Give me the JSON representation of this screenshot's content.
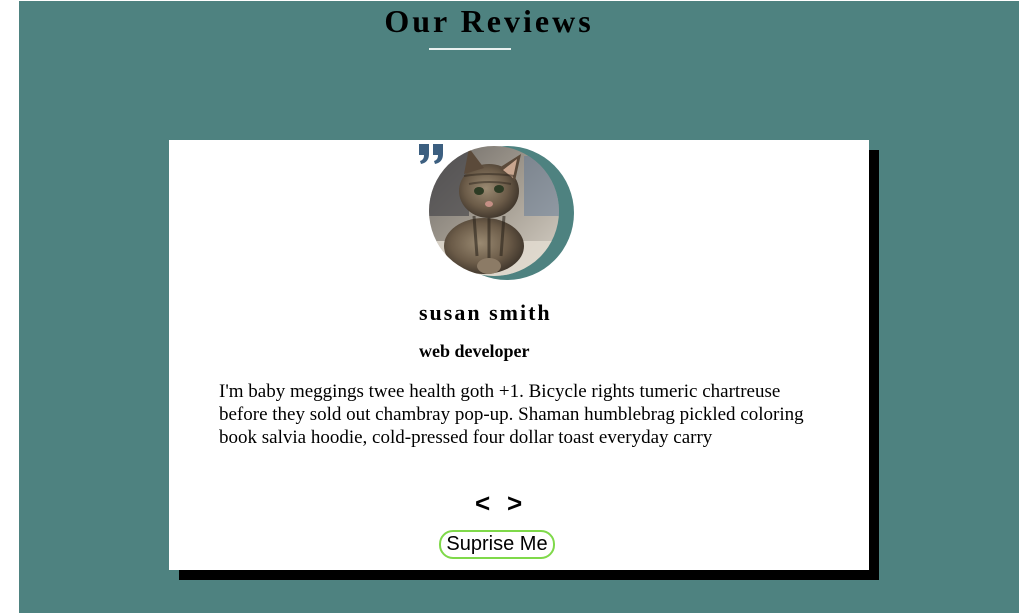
{
  "header": {
    "title": "Our Reviews"
  },
  "review": {
    "name": "susan smith",
    "job": "web developer",
    "text": "I'm baby meggings twee health goth +1. Bicycle rights tumeric chartreuse before they sold out chambray pop-up. Shaman humblebrag pickled coloring book salvia hoodie, cold-pressed four dollar toast everyday carry",
    "avatar_icon": "cat-photo",
    "quote_icon": "quote-right-icon"
  },
  "controls": {
    "prev_label": "<",
    "next_label": ">",
    "random_label": "Suprise Me"
  },
  "colors": {
    "background": "#4e8280",
    "card": "#ffffff",
    "shadow": "#000000",
    "quote": "#3c5f80",
    "button_border": "#7fd94a"
  }
}
